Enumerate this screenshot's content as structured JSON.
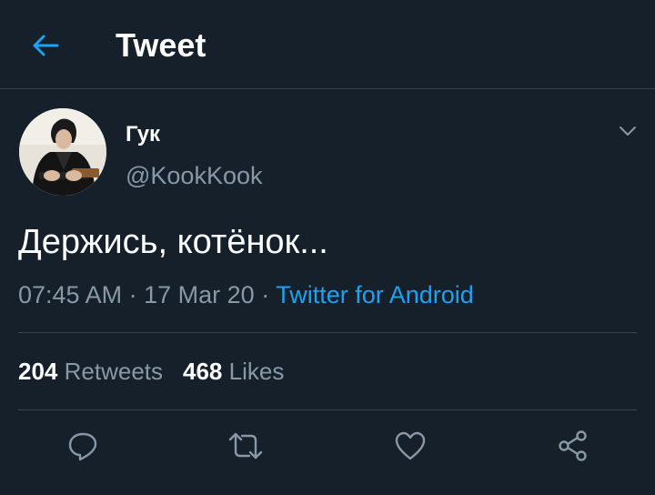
{
  "header": {
    "title": "Tweet",
    "back_icon": "arrow-left-icon"
  },
  "tweet": {
    "author_name": "Гук",
    "author_handle": "@KookKook",
    "text": "Держись, котёнок...",
    "time": "07:45 AM",
    "date": "17 Mar 20",
    "source": "Twitter for Android",
    "separator": "·"
  },
  "stats": {
    "retweets_count": "204",
    "retweets_label": "Retweets",
    "likes_count": "468",
    "likes_label": "Likes"
  },
  "actions": [
    "reply-icon",
    "retweet-icon",
    "like-icon",
    "share-icon"
  ],
  "colors": {
    "background": "#15202b",
    "accent": "#1da1f2",
    "muted": "#8899a6",
    "divider": "#38444d",
    "text": "#ffffff"
  }
}
